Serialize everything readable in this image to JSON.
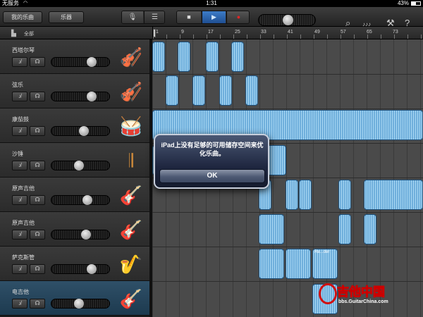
{
  "status_bar": {
    "carrier": "无服务",
    "wifi_icon": "wifi-icon",
    "time": "1:31",
    "battery_percent": "43%",
    "battery_level": 0.43
  },
  "toolbar": {
    "my_songs": "我的乐曲",
    "instruments": "乐器",
    "view_instrument_icon": "microphone-icon",
    "view_tracks_icon": "tracks-view-icon",
    "stop_icon": "stop-icon",
    "play_icon": "play-icon",
    "record_icon": "record-icon",
    "volume_level": 0.5,
    "loop_icon": "loop-icon",
    "guitar_icon": "guitar-notation-icon",
    "wrench_icon": "wrench-icon",
    "help_icon": "help-icon"
  },
  "header": {
    "all_label": "全部"
  },
  "ruler": {
    "bars": [
      "1",
      "9",
      "17",
      "25",
      "33",
      "41",
      "49",
      "57",
      "65",
      "73"
    ]
  },
  "tracks": [
    {
      "name": "西塔尔琴",
      "volume": 0.72,
      "icon": "sitar-icon",
      "glyph": "🎻"
    },
    {
      "name": "弦乐",
      "volume": 0.72,
      "icon": "violin-icon",
      "glyph": "🎻"
    },
    {
      "name": "康茄鼓",
      "volume": 0.56,
      "icon": "conga-icon",
      "glyph": "🥁"
    },
    {
      "name": "沙锤",
      "volume": 0.45,
      "icon": "maracas-icon",
      "glyph": "𝄂"
    },
    {
      "name": "原声吉他",
      "volume": 0.63,
      "icon": "acoustic-guitar-icon",
      "glyph": "🎸"
    },
    {
      "name": "原声吉他",
      "volume": 0.6,
      "icon": "acoustic-guitar-icon",
      "glyph": "🎸"
    },
    {
      "name": "萨克斯管",
      "volume": 0.72,
      "icon": "saxophone-icon",
      "glyph": "🎷"
    },
    {
      "name": "电吉他",
      "volume": 0.45,
      "icon": "electric-guitar-icon",
      "glyph": "🎸"
    }
  ],
  "regions_label": "Re...der",
  "alert": {
    "message": "iPad上没有足够的可用储存空间来优化乐曲。",
    "ok": "OK"
  },
  "watermark": {
    "title": "吉他中国",
    "url": "bbs.GuitarChina.com"
  },
  "colors": {
    "region": "#6eaedb",
    "play": "#2f6bb3",
    "record": "#e02525"
  }
}
